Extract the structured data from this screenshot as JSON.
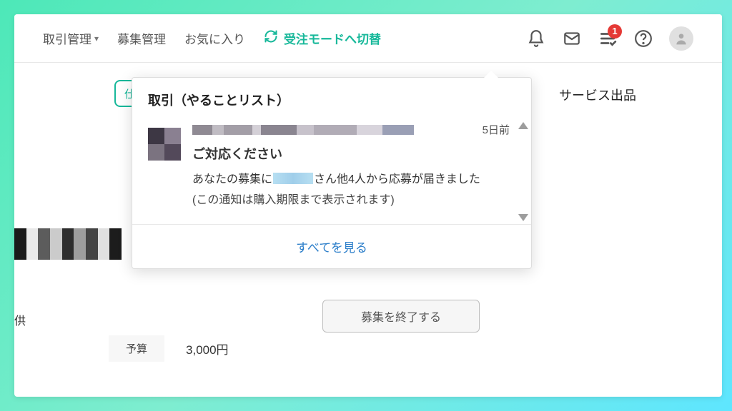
{
  "nav": {
    "transactions": "取引管理",
    "recruitment": "募集管理",
    "favorites": "お気に入り",
    "mode_switch": "受注モードへ切替"
  },
  "notification_badge": "1",
  "right_link": "サービス出品",
  "popover": {
    "title": "取引（やることリスト）",
    "time": "5日前",
    "headline": "ご対応ください",
    "body_prefix": "あなたの募集に",
    "body_suffix": "さん他4人から応募が届きました",
    "note": "(この通知は購入期限まで表示されます)",
    "view_all": "すべてを見る"
  },
  "lower": {
    "supply": "供",
    "end_button": "募集を終了する",
    "budget_label": "予算",
    "budget_value": "3,000円"
  }
}
